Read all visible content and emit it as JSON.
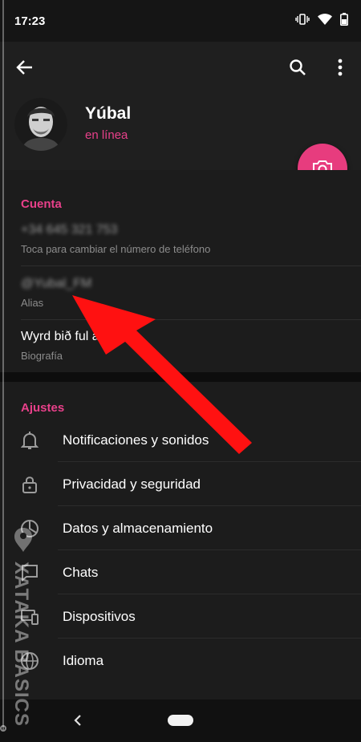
{
  "status_bar": {
    "time": "17:23",
    "icons": [
      "vibrate-icon",
      "wifi-icon",
      "battery-icon"
    ]
  },
  "header": {
    "back_icon": "back-arrow-icon",
    "search_icon": "search-icon",
    "more_icon": "more-vert-icon",
    "name": "Yúbal",
    "status": "en línea",
    "camera_icon": "camera-icon"
  },
  "account": {
    "title": "Cuenta",
    "phone": {
      "value": "+34 645 321 753",
      "label": "Toca para cambiar el número de teléfono"
    },
    "alias": {
      "value": "@Yubal_FM",
      "label": "Alias"
    },
    "bio": {
      "value": "Wyrd bið ful aræd",
      "label": "Biografía"
    }
  },
  "settings": {
    "title": "Ajustes",
    "items": [
      {
        "label": "Notificaciones y sonidos",
        "icon": "bell-icon"
      },
      {
        "label": "Privacidad y seguridad",
        "icon": "lock-icon"
      },
      {
        "label": "Datos y almacenamiento",
        "icon": "pie-chart-icon"
      },
      {
        "label": "Chats",
        "icon": "chat-icon"
      },
      {
        "label": "Dispositivos",
        "icon": "devices-icon"
      },
      {
        "label": "Idioma",
        "icon": "globe-icon"
      }
    ]
  },
  "watermark": {
    "text": "XATAKA BASICS"
  },
  "colors": {
    "accent": "#e8408a",
    "fab": "#e73c7e",
    "annotation_arrow": "#ff1111"
  }
}
